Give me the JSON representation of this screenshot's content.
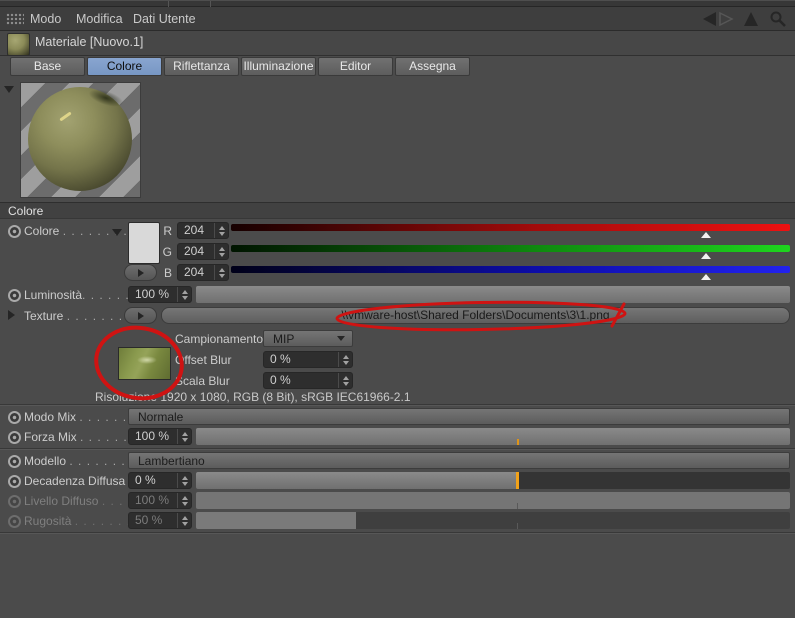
{
  "menu": {
    "items": [
      {
        "label": "Modo"
      },
      {
        "label": "Modifica"
      },
      {
        "label": "Dati Utente"
      }
    ]
  },
  "header": {
    "material_title": "Materiale [Nuovo.1]"
  },
  "tabs": [
    {
      "label": "Base",
      "selected": false
    },
    {
      "label": "Colore",
      "selected": true
    },
    {
      "label": "Riflettanza",
      "selected": false
    },
    {
      "label": "Illuminazione",
      "selected": false
    },
    {
      "label": "Editor",
      "selected": false
    },
    {
      "label": "Assegna",
      "selected": false
    }
  ],
  "section": {
    "title": "Colore"
  },
  "color_row": {
    "label": "Colore",
    "leader": ". . . . . . . .",
    "channels": [
      {
        "name": "R",
        "value": "204"
      },
      {
        "name": "G",
        "value": "204"
      },
      {
        "name": "B",
        "value": "204"
      }
    ]
  },
  "luminosita": {
    "label": "Luminosità",
    "leader": ". . . . . . .",
    "value": "100 %"
  },
  "texture": {
    "label": "Texture",
    "leader": ". . . . . . . . . .",
    "path": "\\\\vmware-host\\Shared Folders\\Documents\\3\\1.png",
    "campionamento_label": "Campionamento",
    "campionamento_value": "MIP",
    "offset_blur_label": "Offset Blur",
    "offset_blur_value": "0 %",
    "scala_blur_label": "Scala Blur",
    "scala_blur_value": "0 %",
    "risoluzione": "Risoluzione 1920 x 1080, RGB (8 Bit), sRGB IEC61966-2.1"
  },
  "modo_mix": {
    "label": "Modo Mix",
    "leader": ". . . . . . .",
    "value": "Normale"
  },
  "forza_mix": {
    "label": "Forza Mix",
    "leader": ". . . . . . . .",
    "value": "100 %"
  },
  "modello": {
    "label": "Modello",
    "leader": ". . . . . . . . .",
    "value": "Lambertiano"
  },
  "decadenza_diffusa": {
    "label": "Decadenza Diffusa",
    "leader": "",
    "value": "0 %"
  },
  "livello_diffuso": {
    "label": "Livello Diffuso",
    "leader": ". . . .",
    "value": "100 %",
    "disabled": true
  },
  "rugosita": {
    "label": "Rugosità",
    "leader": ". . . . . . . .",
    "value": "50 %",
    "disabled": true
  },
  "colors": {
    "tab_accent": "#7e9cc8",
    "annotation_red": "#cf1312",
    "handle_orange": "#f2a219",
    "slider_red_end": "#ee1111",
    "slider_green_end": "#1ed51e",
    "slider_blue_end": "#2222ee"
  }
}
